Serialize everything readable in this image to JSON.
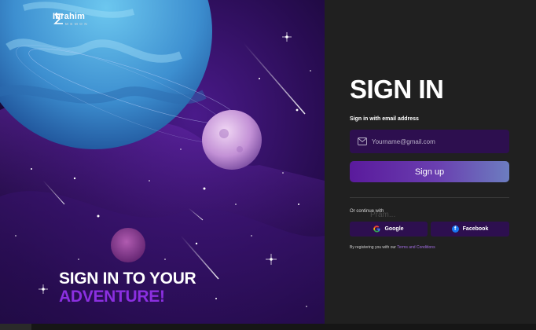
{
  "brand": {
    "name": "Ibrahim",
    "sub": "MEMON"
  },
  "hero": {
    "line1": "SIGN IN TO YOUR",
    "line2": "ADVENTURE!"
  },
  "form": {
    "title": "SIGN IN",
    "email_label": "Sign in with email address",
    "email_placeholder": "Yourname@gmail.com",
    "email_value": "",
    "submit_label": "Sign up",
    "continue_text": "Or continue with",
    "ghost_text": "Pram...",
    "google_label": "Google",
    "facebook_label": "Facebook",
    "terms_prefix": "By registering you with our",
    "terms_link": "Terms and Conditions"
  },
  "colors": {
    "accent": "#8b2fe0",
    "field_bg": "#2d0f4f",
    "panel_bg": "#202020"
  },
  "icons": [
    "logo-mark",
    "mail-icon",
    "google-icon",
    "facebook-icon"
  ]
}
